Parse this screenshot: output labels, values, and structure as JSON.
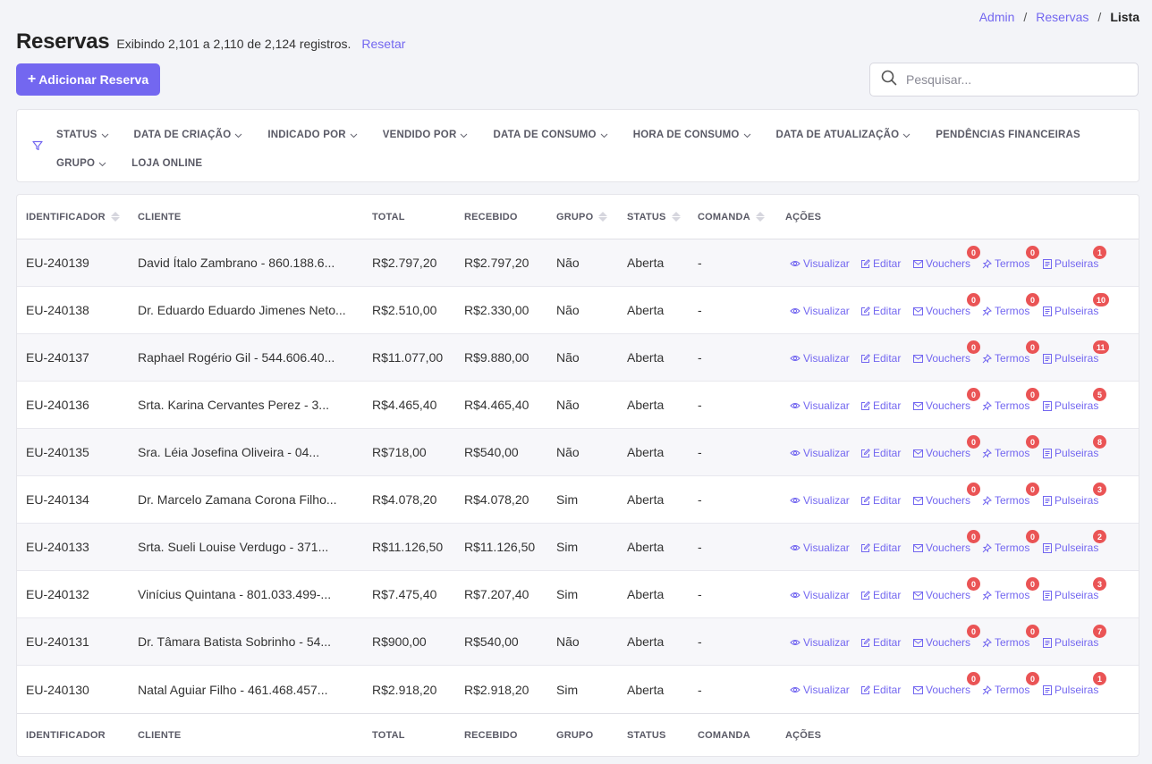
{
  "breadcrumb": {
    "admin": "Admin",
    "sep": "/",
    "reservas": "Reservas",
    "current": "Lista"
  },
  "header": {
    "title": "Reservas",
    "subtitle": "Exibindo 2,101 a 2,110 de 2,124 registros.",
    "reset": "Resetar"
  },
  "add_button": {
    "icon": "+",
    "label": "Adicionar Reserva"
  },
  "search": {
    "placeholder": "Pesquisar..."
  },
  "filters": [
    "STATUS",
    "DATA DE CRIAÇÃO",
    "INDICADO POR",
    "VENDIDO POR",
    "DATA DE CONSUMO",
    "HORA DE CONSUMO",
    "DATA DE ATUALIZAÇÃO",
    "PENDÊNCIAS FINANCEIRAS",
    "GRUPO",
    "LOJA ONLINE"
  ],
  "filters_with_caret": [
    true,
    true,
    true,
    true,
    true,
    true,
    true,
    false,
    true,
    false
  ],
  "table": {
    "headers": {
      "id": "IDENTIFICADOR",
      "client": "CLIENTE",
      "total": "TOTAL",
      "received": "RECEBIDO",
      "group": "GRUPO",
      "status": "STATUS",
      "comanda": "COMANDA",
      "actions": "AÇÕES"
    },
    "action_labels": {
      "view": "Visualizar",
      "edit": "Editar",
      "vouchers": "Vouchers",
      "terms": "Termos",
      "bracelets": "Pulseiras"
    },
    "rows": [
      {
        "id": "EU-240139",
        "client": "David Ítalo Zambrano - 860.188.6...",
        "total": "R$2.797,20",
        "received": "R$2.797,20",
        "group": "Não",
        "status": "Aberta",
        "comanda": "-",
        "vouchers": "0",
        "terms": "0",
        "bracelets": "1"
      },
      {
        "id": "EU-240138",
        "client": "Dr. Eduardo Eduardo Jimenes Neto...",
        "total": "R$2.510,00",
        "received": "R$2.330,00",
        "group": "Não",
        "status": "Aberta",
        "comanda": "-",
        "vouchers": "0",
        "terms": "0",
        "bracelets": "10"
      },
      {
        "id": "EU-240137",
        "client": "Raphael Rogério Gil - 544.606.40...",
        "total": "R$11.077,00",
        "received": "R$9.880,00",
        "group": "Não",
        "status": "Aberta",
        "comanda": "-",
        "vouchers": "0",
        "terms": "0",
        "bracelets": "11"
      },
      {
        "id": "EU-240136",
        "client": "Srta. Karina Cervantes Perez - 3...",
        "total": "R$4.465,40",
        "received": "R$4.465,40",
        "group": "Não",
        "status": "Aberta",
        "comanda": "-",
        "vouchers": "0",
        "terms": "0",
        "bracelets": "5"
      },
      {
        "id": "EU-240135",
        "client": "Sra. Léia Josefina Oliveira - 04...",
        "total": "R$718,00",
        "received": "R$540,00",
        "group": "Não",
        "status": "Aberta",
        "comanda": "-",
        "vouchers": "0",
        "terms": "0",
        "bracelets": "8"
      },
      {
        "id": "EU-240134",
        "client": "Dr. Marcelo Zamana Corona Filho...",
        "total": "R$4.078,20",
        "received": "R$4.078,20",
        "group": "Sim",
        "status": "Aberta",
        "comanda": "-",
        "vouchers": "0",
        "terms": "0",
        "bracelets": "3"
      },
      {
        "id": "EU-240133",
        "client": "Srta. Sueli Louise Verdugo - 371...",
        "total": "R$11.126,50",
        "received": "R$11.126,50",
        "group": "Sim",
        "status": "Aberta",
        "comanda": "-",
        "vouchers": "0",
        "terms": "0",
        "bracelets": "2"
      },
      {
        "id": "EU-240132",
        "client": "Vinícius Quintana - 801.033.499-...",
        "total": "R$7.475,40",
        "received": "R$7.207,40",
        "group": "Sim",
        "status": "Aberta",
        "comanda": "-",
        "vouchers": "0",
        "terms": "0",
        "bracelets": "3"
      },
      {
        "id": "EU-240131",
        "client": "Dr. Tâmara Batista Sobrinho - 54...",
        "total": "R$900,00",
        "received": "R$540,00",
        "group": "Não",
        "status": "Aberta",
        "comanda": "-",
        "vouchers": "0",
        "terms": "0",
        "bracelets": "7"
      },
      {
        "id": "EU-240130",
        "client": "Natal Aguiar Filho - 461.468.457...",
        "total": "R$2.918,20",
        "received": "R$2.918,20",
        "group": "Sim",
        "status": "Aberta",
        "comanda": "-",
        "vouchers": "0",
        "terms": "0",
        "bracelets": "1"
      }
    ]
  },
  "colors": {
    "accent": "#7367f0",
    "badge": "#ea5455",
    "background": "#f3f4f8"
  },
  "icons": {
    "search": "search-icon",
    "filter": "filter-icon",
    "view": "eye-icon",
    "edit": "edit-icon",
    "vouchers": "mail-icon",
    "terms": "pin-icon",
    "bracelets": "document-icon"
  }
}
